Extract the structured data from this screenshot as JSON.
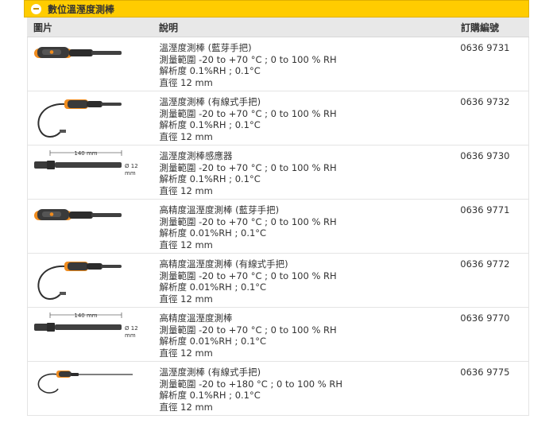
{
  "section": {
    "title": "數位溫溼度測棒"
  },
  "table": {
    "headers": {
      "image": "圖片",
      "description": "說明",
      "order_no": "訂購編號"
    },
    "rows": [
      {
        "probe": "handle-orange",
        "lines": [
          "溫溼度測棒 (藍芽手把)",
          "測量範圍 -20 to +70 °C ; 0 to 100 % RH",
          "解析度 0.1%RH ; 0.1°C",
          "直徑 12 mm"
        ],
        "order_no": "0636 9731"
      },
      {
        "probe": "cable",
        "lines": [
          "溫溼度測棒 (有線式手把)",
          "測量範圍 -20 to +70 °C ; 0 to 100 % RH",
          "解析度 0.1%RH ; 0.1°C",
          "直徑 12 mm"
        ],
        "order_no": "0636 9732"
      },
      {
        "probe": "sensor",
        "dim_length": "140 mm",
        "dim_diam": "Ø 12",
        "dim_unit": "mm",
        "lines": [
          "溫溼度測棒感應器",
          "測量範圍 -20 to +70 °C ; 0 to 100 % RH",
          "解析度 0.1%RH ; 0.1°C",
          "直徑 12 mm"
        ],
        "order_no": "0636 9730"
      },
      {
        "probe": "handle-orange",
        "lines": [
          "高精度溫溼度測棒 (藍芽手把)",
          "測量範圍 -20 to +70 °C ; 0 to 100 % RH",
          "解析度 0.01%RH ; 0.1°C",
          "直徑 12 mm"
        ],
        "order_no": "0636 9771"
      },
      {
        "probe": "cable",
        "lines": [
          "高精度溫溼度測棒 (有線式手把)",
          "測量範圍 -20 to +70 °C ; 0 to 100 % RH",
          "解析度 0.01%RH ; 0.1°C",
          "直徑 12 mm"
        ],
        "order_no": "0636 9772"
      },
      {
        "probe": "sensor",
        "dim_length": "140 mm",
        "dim_diam": "Ø 12",
        "dim_unit": "mm",
        "lines": [
          "高精度溫溼度測棒",
          "測量範圍 -20 to +70 °C ; 0 to 100 % RH",
          "解析度 0.01%RH ; 0.1°C",
          "直徑 12 mm"
        ],
        "order_no": "0636 9770"
      },
      {
        "probe": "cable-thin",
        "lines": [
          "溫溼度測棒 (有線式手把)",
          "測量範圍 -20 to +180 °C ; 0 to 100 % RH",
          "解析度 0.1%RH ; 0.1°C",
          "直徑 12 mm"
        ],
        "order_no": "0636 9775"
      }
    ]
  },
  "colors": {
    "header_bar": "#ffcc00",
    "table_head": "#e8e8e8",
    "probe_orange": "#f08c1e",
    "probe_body": "#3a3a3a"
  }
}
